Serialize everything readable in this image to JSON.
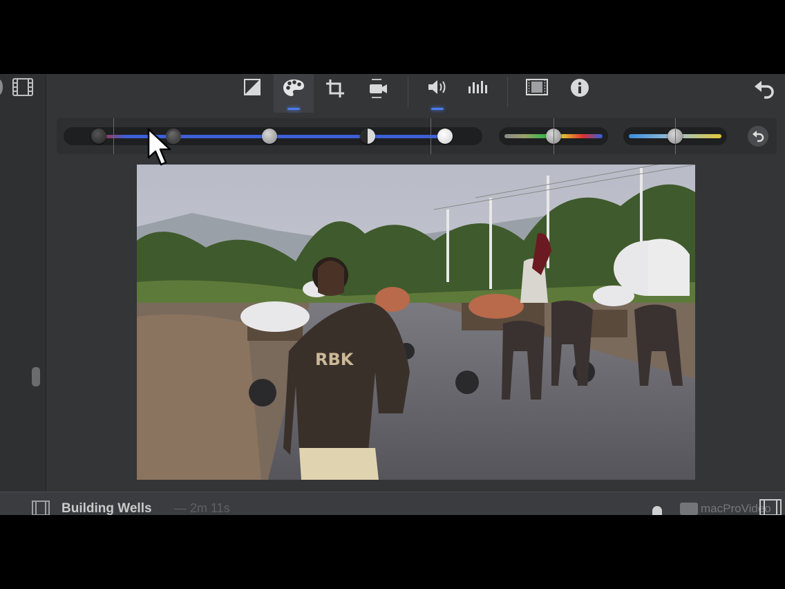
{
  "toolbar": {
    "tools": [
      {
        "icon": "color-balance-icon",
        "selected": false
      },
      {
        "icon": "color-correction-palette-icon",
        "selected": true
      },
      {
        "icon": "crop-icon",
        "selected": false
      },
      {
        "icon": "stabilization-camera-icon",
        "selected": false
      },
      {
        "icon": "volume-icon",
        "selected": false,
        "active_dot": true
      },
      {
        "icon": "equalizer-icon",
        "selected": false
      },
      {
        "icon": "clip-filter-icon",
        "selected": false
      },
      {
        "icon": "info-icon",
        "selected": false
      }
    ],
    "undo_icon": "undo-arrow-icon"
  },
  "color_correction": {
    "exposure_track": {
      "knobs": [
        0.08,
        0.25,
        0.5,
        0.8,
        1.0
      ]
    },
    "saturation_level": 0.5,
    "temperature_level": 0.5,
    "accent": "#3d5fd8"
  },
  "project": {
    "title": "Building Wells",
    "duration": "— 2m 11s"
  },
  "watermark": "macProVideo",
  "colors": {
    "accent": "#4b7cf0",
    "background": "#343537"
  }
}
